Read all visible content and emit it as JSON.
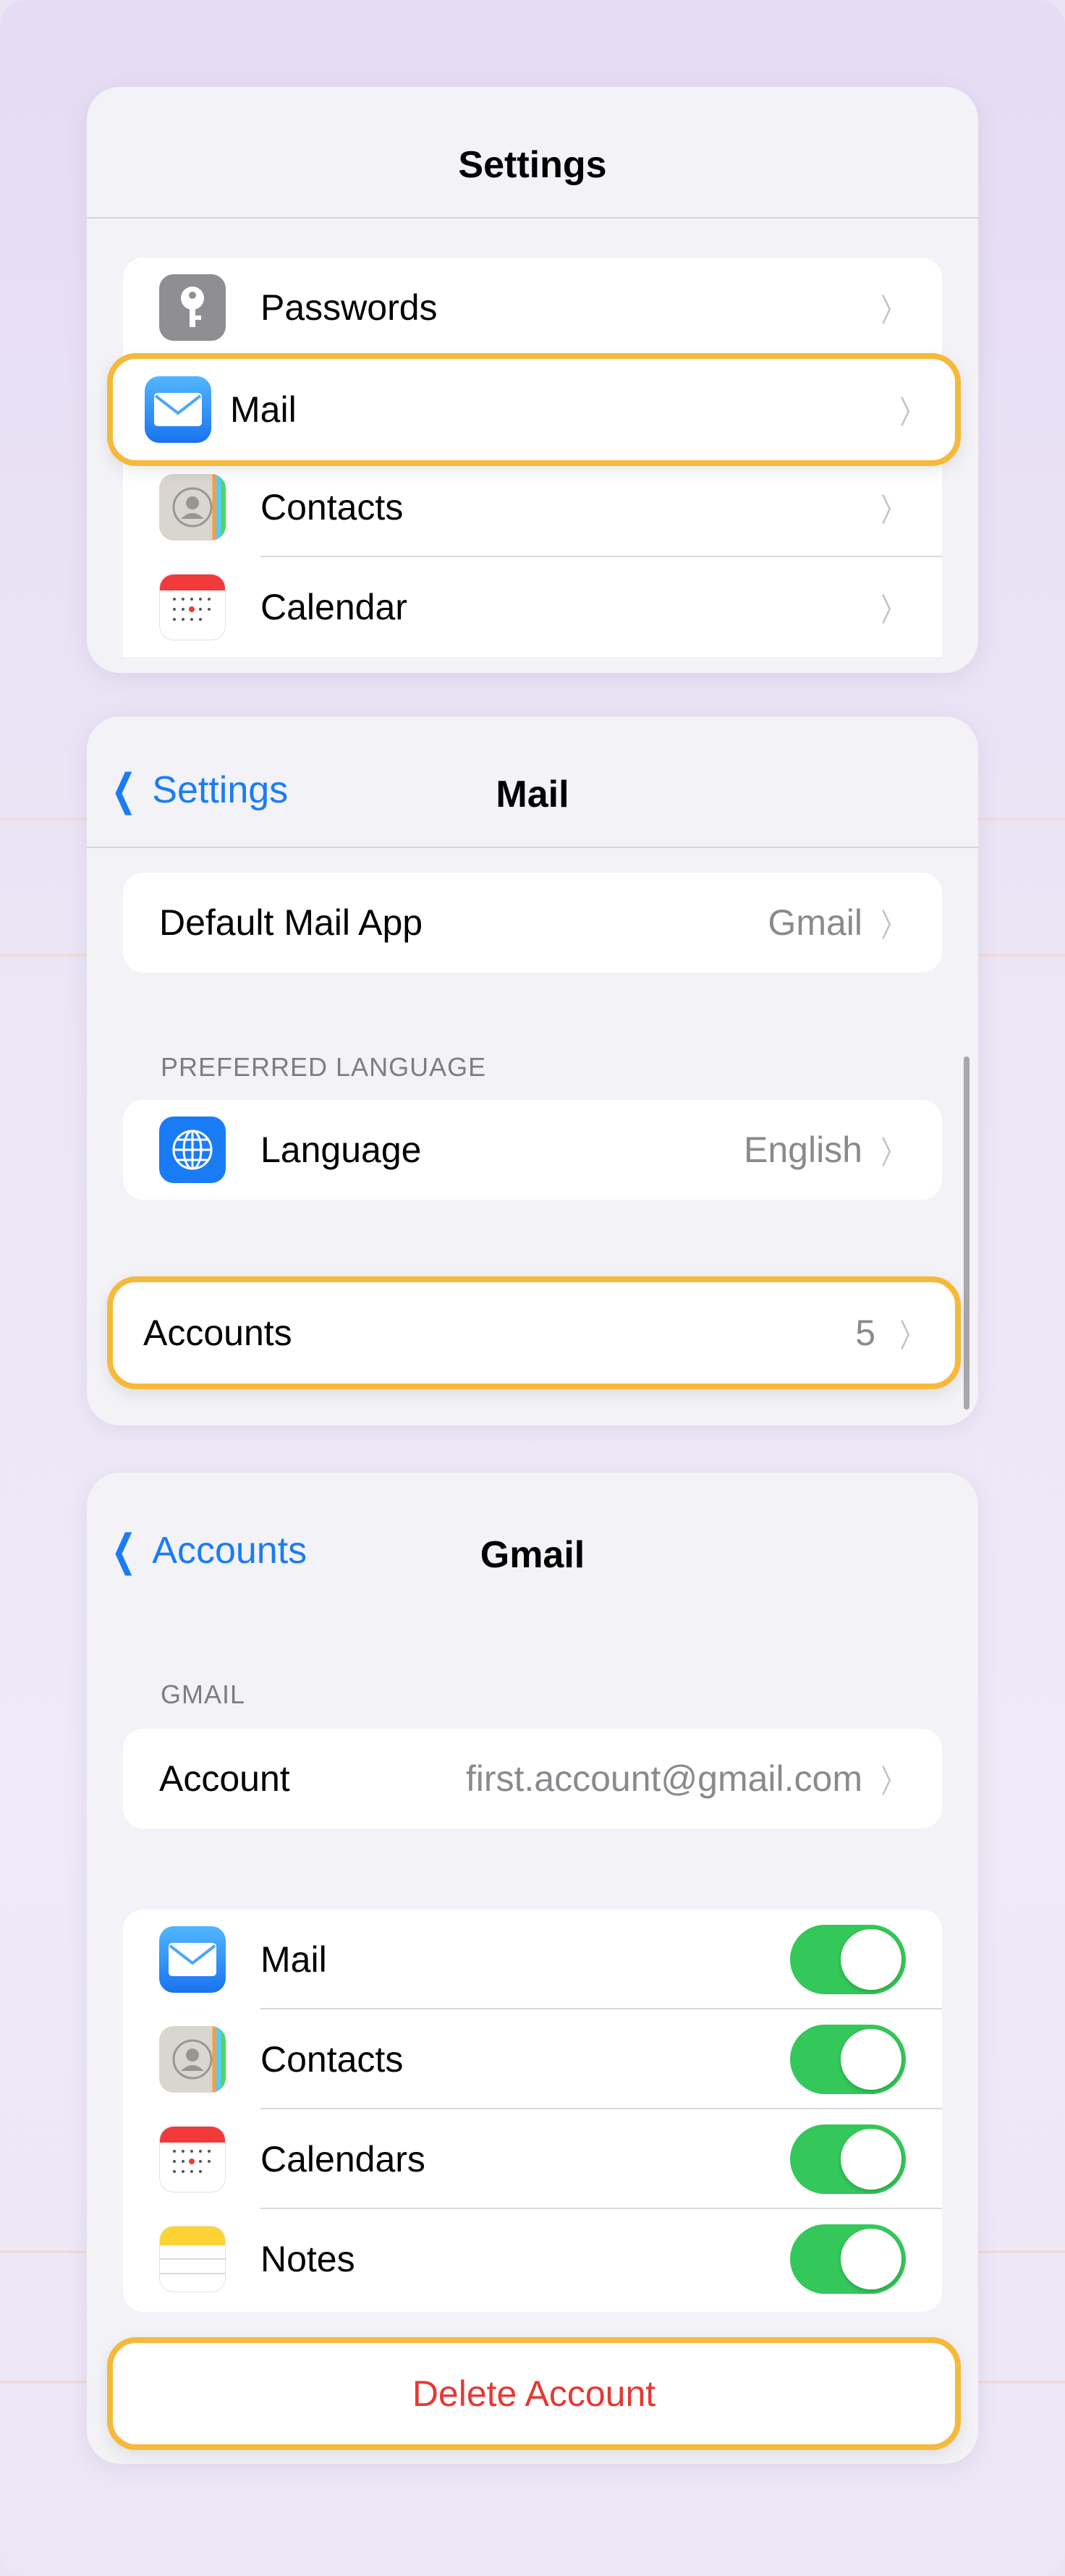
{
  "settings_panel": {
    "title": "Settings",
    "items": [
      {
        "label": "Passwords",
        "icon": "key-icon"
      },
      {
        "label": "Mail",
        "icon": "mail-icon"
      },
      {
        "label": "Contacts",
        "icon": "contacts-icon"
      },
      {
        "label": "Calendar",
        "icon": "calendar-icon"
      }
    ]
  },
  "mail_panel": {
    "back_label": "Settings",
    "title": "Mail",
    "default_mail_app": {
      "label": "Default Mail App",
      "value": "Gmail"
    },
    "preferred_language_header": "PREFERRED LANGUAGE",
    "language": {
      "label": "Language",
      "value": "English",
      "icon": "globe-icon"
    },
    "accounts": {
      "label": "Accounts",
      "value": "5"
    }
  },
  "gmail_panel": {
    "back_label": "Accounts",
    "title": "Gmail",
    "section_header": "GMAIL",
    "account": {
      "label": "Account",
      "value": "first.account@gmail.com"
    },
    "toggles": [
      {
        "label": "Mail",
        "icon": "mail-icon",
        "on": true
      },
      {
        "label": "Contacts",
        "icon": "contacts-icon",
        "on": true
      },
      {
        "label": "Calendars",
        "icon": "calendar-icon",
        "on": true
      },
      {
        "label": "Notes",
        "icon": "notes-icon",
        "on": true
      }
    ],
    "delete_label": "Delete Account"
  },
  "colors": {
    "highlight": "#f6b93b",
    "link_blue": "#1a7cf5",
    "toggle_green": "#34c759",
    "destructive_red": "#e53935"
  }
}
